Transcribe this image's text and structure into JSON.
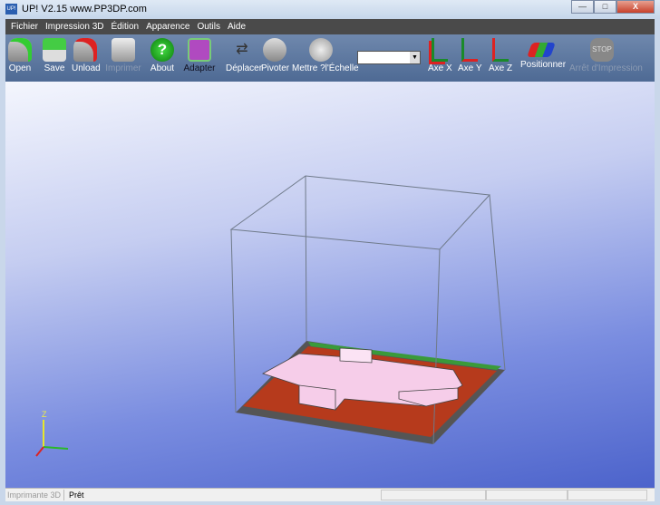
{
  "window": {
    "title": "UP!  V2.15 www.PP3DP.com",
    "app_icon": "UP!",
    "minimize": "—",
    "maximize": "□",
    "close": "X"
  },
  "menu": [
    "Fichier",
    "Impression 3D",
    "Édition",
    "Apparence",
    "Outils",
    "Aide"
  ],
  "toolbar": {
    "open": "Open",
    "save": "Save",
    "unload": "Unload",
    "print": "Imprimer",
    "about": "About",
    "fit": "Adapter",
    "move": "Déplacer",
    "rotate": "Pivoter",
    "scale": "Mettre ?l'Échelle",
    "axis_x": "Axe X",
    "axis_y": "Axe Y",
    "axis_z": "Axe Z",
    "place": "Positionner",
    "stop": "Arrêt d'Impression",
    "stop_icon_text": "STOP",
    "about_icon_text": "?",
    "combo_value": ""
  },
  "status": {
    "printer": "Imprimante 3D",
    "state": "Prêt"
  },
  "axes": {
    "z": "Z"
  },
  "colors": {
    "toolbar": "#5a76a0",
    "platform": "#5a5a5a",
    "grid_red": "#b83a1a",
    "model": "#f4c8e8"
  }
}
